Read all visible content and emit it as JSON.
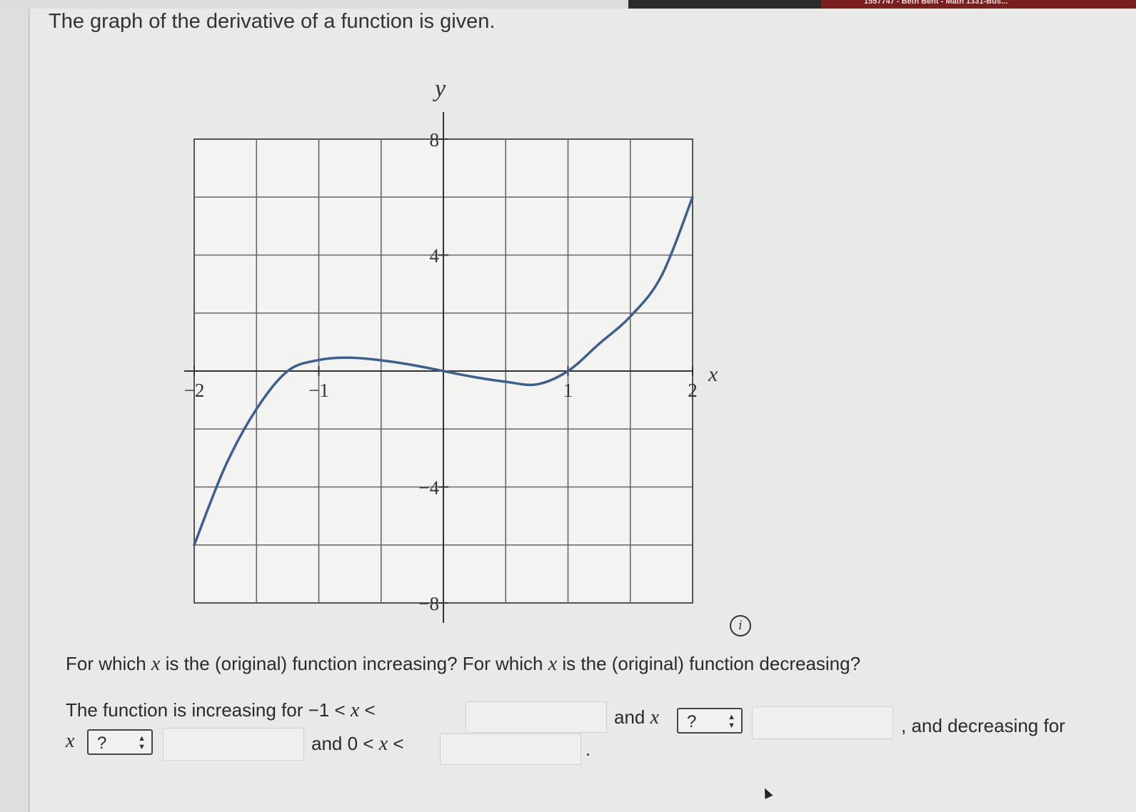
{
  "browser": {
    "tab_text": "1557747 - Beth Bent - Math 1331-Bus..."
  },
  "question": {
    "title": "The graph of the derivative of a function is given.",
    "prompt_part1": "For which ",
    "prompt_var1": "x",
    "prompt_part2": " is the (original) function increasing? For which ",
    "prompt_var2": "x",
    "prompt_part3": " is the (original) function decreasing?",
    "info_symbol": "i"
  },
  "answer": {
    "line1_prefix": "The function is increasing for −1 < ",
    "line1_var": "x",
    "line1_suffix": " <",
    "and_label": "and ",
    "and_var": "x",
    "decreasing_label": ", and decreasing for",
    "line2_var": "x",
    "and2_label": "and 0 < ",
    "and2_var": "x",
    "and2_suffix": " <",
    "period": ".",
    "select1_value": "?",
    "select2_value": "?",
    "blank1_value": "",
    "blank2_value": "",
    "blank3_value": "",
    "blank4_value": ""
  },
  "chart_data": {
    "type": "line",
    "title": "",
    "xlabel": "x",
    "ylabel": "y",
    "xlim": [
      -2,
      2
    ],
    "ylim": [
      -8,
      8
    ],
    "x_ticks": [
      -2,
      -1,
      1,
      2
    ],
    "x_tick_labels": [
      "−2",
      "−1",
      "1",
      "2"
    ],
    "y_ticks": [
      8,
      4,
      -4,
      -8
    ],
    "y_tick_labels": [
      "8",
      "4",
      "−4",
      "−8"
    ],
    "grid": true,
    "grid_step_x": 0.5,
    "grid_step_y": 2,
    "curve_color": "#3b5f8f",
    "series": [
      {
        "name": "",
        "x": [
          -2,
          -1.75,
          -1.5,
          -1.25,
          -1,
          -0.75,
          -0.5,
          -0.25,
          0,
          0.25,
          0.5,
          0.75,
          1,
          1.25,
          1.5,
          1.75,
          2
        ],
        "y": [
          -6,
          -3.28,
          -1.31,
          0,
          0.38,
          0.46,
          0.37,
          0.21,
          0,
          -0.21,
          -0.37,
          -0.46,
          0,
          0.94,
          1.88,
          3.28,
          6
        ]
      }
    ]
  }
}
